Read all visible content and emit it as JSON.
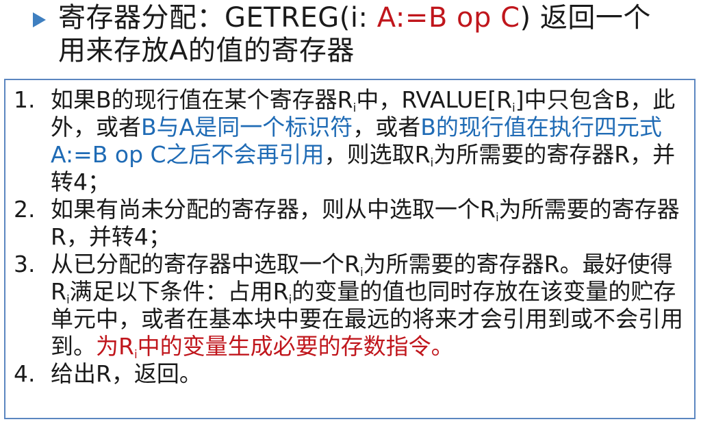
{
  "heading": {
    "prefix": "寄存器分配：GETREG(i: ",
    "highlight": "A:=B op C",
    "middle": ") 返回一个",
    "line2": "用来存放A的值的寄存器"
  },
  "items": [
    {
      "number": "1.",
      "t1": "如果B的现行值在某个寄存器R",
      "s1": "i",
      "t2": "中，RVALUE[R",
      "s2": "i",
      "t3": "]中只包含B，此外，或者",
      "b1": "B与A是同一个标识符",
      "t4": "，或者",
      "b2": "B的现行值在执行四元式A:=B op C之后不会再引用",
      "t5": "，则选取R",
      "s3": "i",
      "t6": "为所需要的寄存器R，并转4；"
    },
    {
      "number": "2.",
      "t1": "如果有尚未分配的寄存器，则从中选取一个R",
      "s1": "i",
      "t2": "为所需要的寄存器R，并转4；"
    },
    {
      "number": "3.",
      "t1": "从已分配的寄存器中选取一个R",
      "s1": "i",
      "t2": "为所需要的寄存器R。最好使得R",
      "s2": "i",
      "t3": "满足以下条件：占用R",
      "s3": "i",
      "t4": "的变量的值也同时存放在该变量的贮存单元中，或者在基本块中要在最远的将来才会引用到或不会引用到。",
      "r1": "为R",
      "rs": "i",
      "r2": "中的变量生成必要的存数指令。"
    },
    {
      "number": "4.",
      "t1": "给出R，返回。"
    }
  ],
  "colors": {
    "bullet": "#3f7fc0",
    "highlight_red": "#c0161c",
    "highlight_blue": "#1f6bb5",
    "box_border": "#5b86c0"
  }
}
